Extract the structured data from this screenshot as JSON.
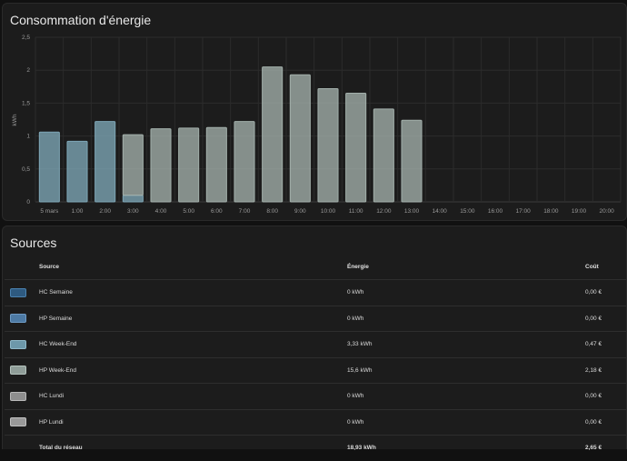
{
  "chart_card": {
    "title": "Consommation d'énergie"
  },
  "chart_data": {
    "type": "bar",
    "title": "Consommation d'énergie",
    "ylabel": "kWh",
    "xlabel": "",
    "ylim": [
      0,
      2.5
    ],
    "y_ticks": [
      "0",
      "0,5",
      "1",
      "1,5",
      "2",
      "2,5"
    ],
    "y_tick_values": [
      0,
      0.5,
      1,
      1.5,
      2,
      2.5
    ],
    "categories": [
      "5 mars",
      "1:00",
      "2:00",
      "3:00",
      "4:00",
      "5:00",
      "6:00",
      "7:00",
      "8:00",
      "9:00",
      "10:00",
      "11:00",
      "12:00",
      "13:00",
      "14:00",
      "15:00",
      "16:00",
      "17:00",
      "18:00",
      "19:00",
      "20:00"
    ],
    "stacked": true,
    "grid": true,
    "series": [
      {
        "name": "HC Week-End",
        "color": "#7ea6b6",
        "values": [
          1.06,
          0.92,
          1.22,
          0.1,
          0,
          0,
          0,
          0,
          0,
          0,
          0,
          0,
          0,
          0,
          null,
          null,
          null,
          null,
          null,
          null,
          null
        ]
      },
      {
        "name": "HP Week-End",
        "color": "#a3b0ab",
        "values": [
          0,
          0,
          0,
          0.92,
          1.11,
          1.12,
          1.13,
          1.22,
          2.05,
          1.93,
          1.72,
          1.65,
          1.41,
          1.24,
          null,
          null,
          null,
          null,
          null,
          null,
          null
        ]
      }
    ]
  },
  "sources_card": {
    "title": "Sources",
    "headers": {
      "source": "Source",
      "energy": "Énergie",
      "cost": "Coût"
    },
    "rows": [
      {
        "name": "HC Semaine",
        "energy": "0 kWh",
        "cost": "0,00 €",
        "fill": "#2e5a80",
        "border": "#4a82b0"
      },
      {
        "name": "HP Semaine",
        "energy": "0 kWh",
        "cost": "0,00 €",
        "fill": "#4d7aa4",
        "border": "#6f9bc5"
      },
      {
        "name": "HC Week-End",
        "energy": "3,33 kWh",
        "cost": "0,47 €",
        "fill": "#6d98aa",
        "border": "#8fb8c8"
      },
      {
        "name": "HP Week-End",
        "energy": "15,6 kWh",
        "cost": "2,18 €",
        "fill": "#8f9d98",
        "border": "#b5c3be"
      },
      {
        "name": "HC Lundi",
        "energy": "0 kWh",
        "cost": "0,00 €",
        "fill": "#8e8e8e",
        "border": "#b8b8b8"
      },
      {
        "name": "HP Lundi",
        "energy": "0 kWh",
        "cost": "0,00 €",
        "fill": "#999999",
        "border": "#c2c2c2"
      }
    ],
    "total": {
      "label": "Total du réseau",
      "energy": "18,93 kWh",
      "cost": "2,65 €"
    }
  }
}
